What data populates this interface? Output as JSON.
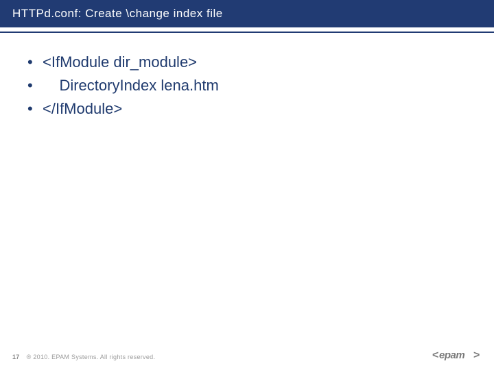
{
  "title": "HTTPd.conf: Create \\change index file",
  "bullets": [
    "<IfModule dir_module>",
    "    DirectoryIndex lena.htm",
    "</IfModule>"
  ],
  "footer": {
    "page": "17",
    "copyright": "® 2010. EPAM Systems. All rights reserved."
  },
  "logo_text": "epam"
}
